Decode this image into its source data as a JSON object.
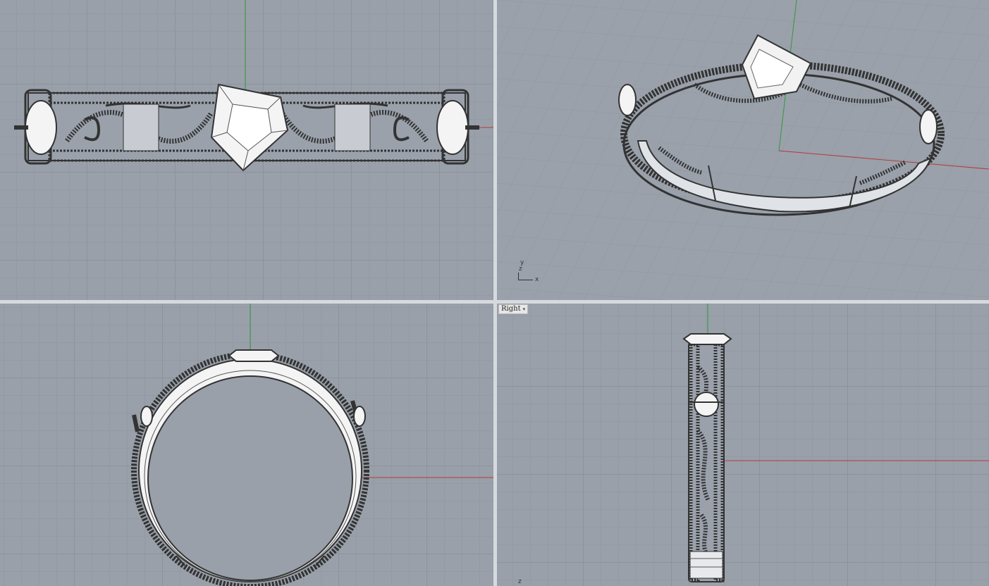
{
  "viewports": {
    "top": {
      "title": ""
    },
    "perspective": {
      "title": "",
      "axis_icon": {
        "y": "y",
        "z": "z",
        "x": "x"
      }
    },
    "front": {
      "title": ""
    },
    "right": {
      "title": "Right",
      "axis_icon": {
        "z": "z"
      }
    }
  },
  "colors": {
    "viewport_bg": "#99a0aa",
    "grid_minor": "#939aa4",
    "grid_major": "#8c939d",
    "axis_x": "#b53a3a",
    "axis_y": "#2f9a3a",
    "wire": "#333333",
    "stone": "#f4f4f4"
  },
  "icons": [
    "dropdown-caret-icon",
    "axis-icon"
  ]
}
